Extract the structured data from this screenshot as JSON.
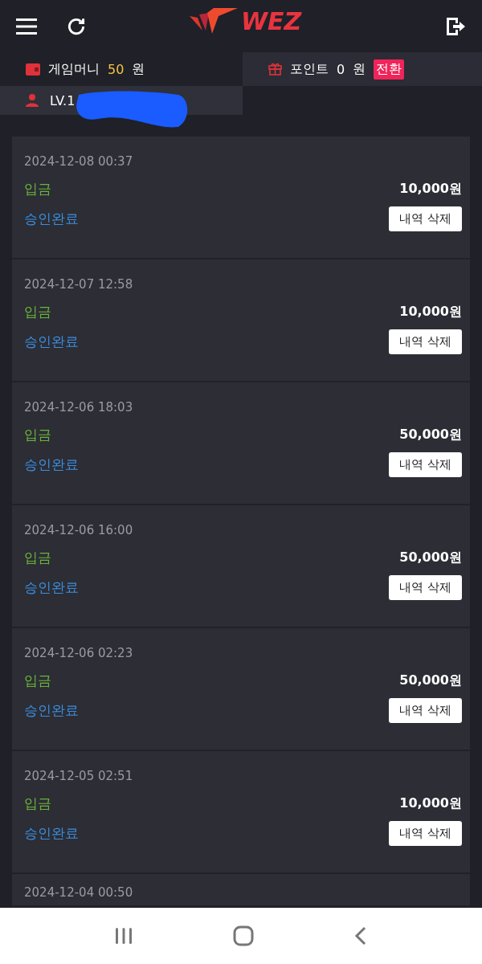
{
  "header": {
    "logo": "WEZ"
  },
  "wallet": {
    "label": "게임머니",
    "amount": "50",
    "unit": "원"
  },
  "points": {
    "label": "포인트",
    "amount": "0",
    "unit": "원",
    "convert": "전환"
  },
  "user": {
    "level": "LV.1"
  },
  "records": [
    {
      "date": "2024-12-08 00:37",
      "type": "입금",
      "amount": "10,000원",
      "status": "승인완료",
      "action": "내역 삭제"
    },
    {
      "date": "2024-12-07 12:58",
      "type": "입금",
      "amount": "10,000원",
      "status": "승인완료",
      "action": "내역 삭제"
    },
    {
      "date": "2024-12-06 18:03",
      "type": "입금",
      "amount": "50,000원",
      "status": "승인완료",
      "action": "내역 삭제"
    },
    {
      "date": "2024-12-06 16:00",
      "type": "입금",
      "amount": "50,000원",
      "status": "승인완료",
      "action": "내역 삭제"
    },
    {
      "date": "2024-12-06 02:23",
      "type": "입금",
      "amount": "50,000원",
      "status": "승인완료",
      "action": "내역 삭제"
    },
    {
      "date": "2024-12-05 02:51",
      "type": "입금",
      "amount": "10,000원",
      "status": "승인완료",
      "action": "내역 삭제"
    },
    {
      "date": "2024-12-04 00:50"
    }
  ]
}
